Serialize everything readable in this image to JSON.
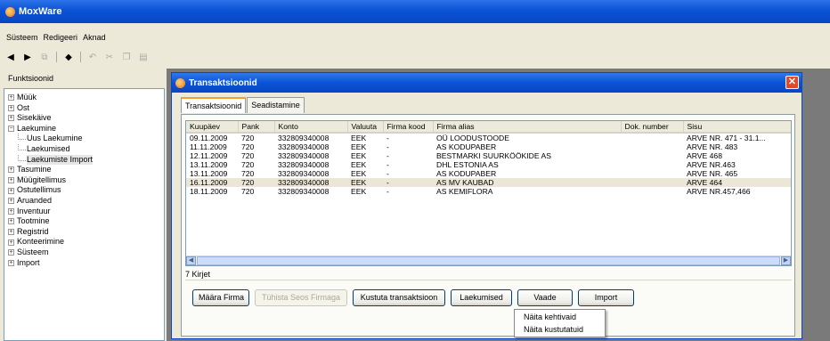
{
  "app": {
    "title": "MoxWare"
  },
  "menu": [
    "Süsteem",
    "Redigeeri",
    "Aknad"
  ],
  "left": {
    "header": "Funktsioonid",
    "tree": [
      {
        "label": "Müük",
        "sign": "+"
      },
      {
        "label": "Ost",
        "sign": "+"
      },
      {
        "label": "Sisekäive",
        "sign": "+"
      },
      {
        "label": "Laekumine",
        "sign": "−"
      },
      {
        "label": "Uus Laekumine",
        "child": true
      },
      {
        "label": "Laekumised",
        "child": true
      },
      {
        "label": "Laekumiste Import",
        "child": true,
        "selected": true
      },
      {
        "label": "Tasumine",
        "sign": "+"
      },
      {
        "label": "Müügitellimus",
        "sign": "+"
      },
      {
        "label": "Ostutellimus",
        "sign": "+"
      },
      {
        "label": "Aruanded",
        "sign": "+"
      },
      {
        "label": "Inventuur",
        "sign": "+"
      },
      {
        "label": "Tootmine",
        "sign": "+"
      },
      {
        "label": "Registrid",
        "sign": "+"
      },
      {
        "label": "Konteerimine",
        "sign": "+"
      },
      {
        "label": "Süsteem",
        "sign": "+"
      },
      {
        "label": "Import",
        "sign": "+"
      }
    ]
  },
  "window": {
    "title": "Transaktsioonid",
    "close": "✕",
    "tabs": [
      "Transaktsioonid",
      "Seadistamine"
    ],
    "columns": [
      "Kuupäev",
      "Pank",
      "Konto",
      "Valuuta",
      "Firma kood",
      "Firma alias",
      "Dok. number",
      "Sisu"
    ],
    "rows": [
      [
        "09.11.2009",
        "720",
        "332809340008",
        "EEK",
        "-",
        "OÜ LOODUSTOODE",
        "",
        "ARVE NR. 471 - 31.1..."
      ],
      [
        "11.11.2009",
        "720",
        "332809340008",
        "EEK",
        "-",
        "AS KODUPABER",
        "",
        "ARVE NR. 483"
      ],
      [
        "12.11.2009",
        "720",
        "332809340008",
        "EEK",
        "-",
        "BESTMARKI SUURKÖÖKIDE AS",
        "",
        "ARVE 468"
      ],
      [
        "13.11.2009",
        "720",
        "332809340008",
        "EEK",
        "-",
        "DHL ESTONIA AS",
        "",
        "ARVE NR.463"
      ],
      [
        "13.11.2009",
        "720",
        "332809340008",
        "EEK",
        "-",
        "AS KODUPABER",
        "",
        "ARVE NR. 465"
      ],
      [
        "16.11.2009",
        "720",
        "332809340008",
        "EEK",
        "-",
        "AS MV KAUBAD",
        "",
        "ARVE 464"
      ],
      [
        "18.11.2009",
        "720",
        "332809340008",
        "EEK",
        "-",
        "AS KEMIFLORA",
        "",
        "ARVE NR.457,466"
      ]
    ],
    "count": "7 Kirjet",
    "buttons": {
      "maara": "Määra Firma",
      "tyhista": "Tühista Seos Firmaga",
      "kustuta": "Kustuta transaktsioon",
      "laekumised": "Laekumised",
      "vaade": "Vaade",
      "import": "Import"
    },
    "dropdown": [
      "Näita kehtivaid",
      "Näita kustutatuid"
    ]
  }
}
